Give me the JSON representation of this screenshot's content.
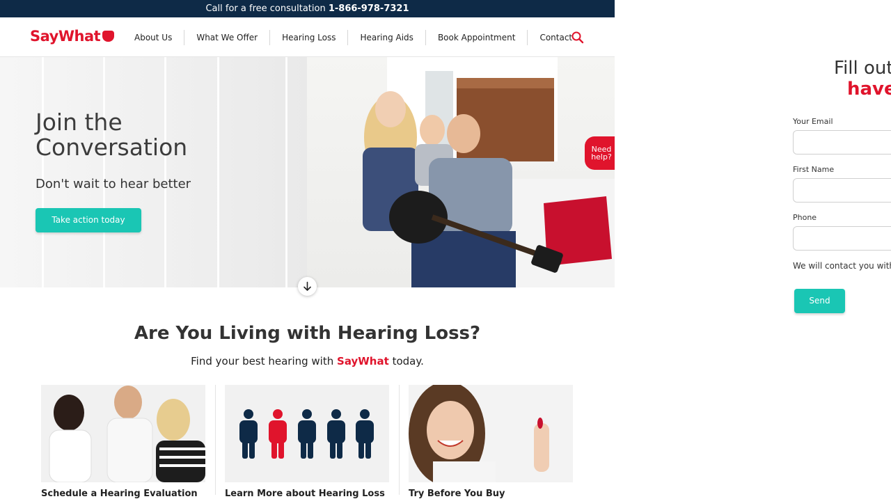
{
  "topbar": {
    "text": "Call for a free consultation",
    "phone": "1-866-978-7321"
  },
  "brand": {
    "logo_text": "SayWhat",
    "color": "#e0142c",
    "accent": "#1ac6b4",
    "navy": "#0e2a47"
  },
  "nav": {
    "items": [
      {
        "label": "About Us"
      },
      {
        "label": "What We Offer"
      },
      {
        "label": "Hearing Loss"
      },
      {
        "label": "Hearing Aids"
      },
      {
        "label": "Book Appointment"
      },
      {
        "label": "Contact"
      }
    ],
    "search_icon": "search-icon"
  },
  "hero": {
    "title": "Join the Conversation",
    "subtitle": "Don't wait to hear better",
    "cta": "Take action today",
    "need_help": "Need help?",
    "scroll_icon": "arrow-down-icon"
  },
  "section": {
    "title": "Are You Living with Hearing Loss?",
    "subtitle_pre": "Find your best hearing with",
    "subtitle_brand": "SayWhat",
    "subtitle_post": "today.",
    "cards": [
      {
        "caption": "Schedule a Hearing Evaluation"
      },
      {
        "caption": "Learn More about Hearing Loss"
      },
      {
        "caption": "Try Before You Buy"
      }
    ]
  },
  "form": {
    "title_line1": "Fill out",
    "title_line2": "have",
    "fields": [
      {
        "label": "Your Email",
        "value": ""
      },
      {
        "label": "First Name",
        "value": ""
      },
      {
        "label": "Phone",
        "value": ""
      }
    ],
    "note": "We will contact you with",
    "submit": "Send"
  }
}
